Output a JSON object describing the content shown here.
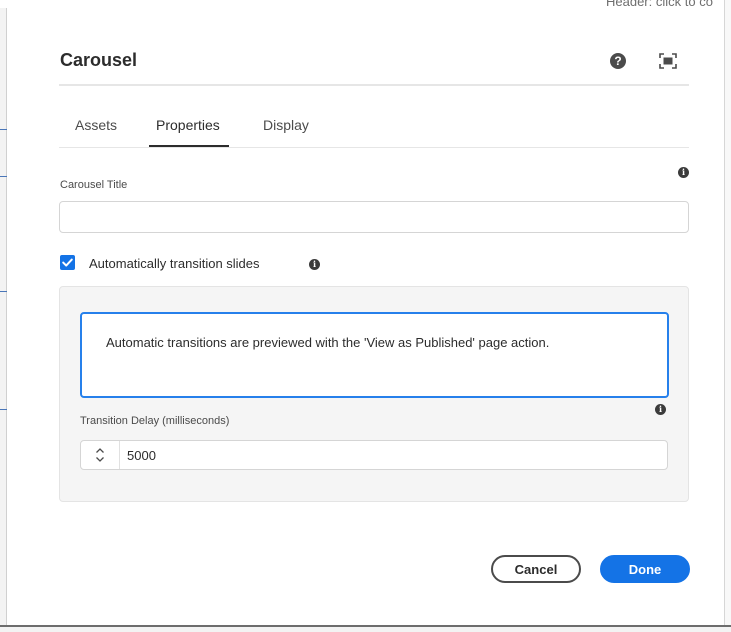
{
  "background": {
    "header_hint": "Header: click to co"
  },
  "dialog": {
    "title": "Carousel",
    "icons": {
      "help": "help-icon",
      "fullscreen": "fullscreen-icon"
    }
  },
  "tabs": [
    {
      "label": "Assets",
      "active": false
    },
    {
      "label": "Properties",
      "active": true
    },
    {
      "label": "Display",
      "active": false
    }
  ],
  "properties": {
    "title_field": {
      "label": "Carousel Title",
      "value": "",
      "placeholder": ""
    },
    "auto_transition": {
      "label": "Automatically transition slides",
      "checked": true
    },
    "notice_text": "Automatic transitions are previewed with the 'View as Published' page action.",
    "delay_field": {
      "label": "Transition Delay (milliseconds)",
      "value": "5000"
    }
  },
  "footer": {
    "cancel_label": "Cancel",
    "done_label": "Done"
  },
  "colors": {
    "accent": "#1473e6",
    "notice_border": "#2680eb",
    "panel_bg": "#f5f5f5",
    "text": "#2c2c2c"
  }
}
